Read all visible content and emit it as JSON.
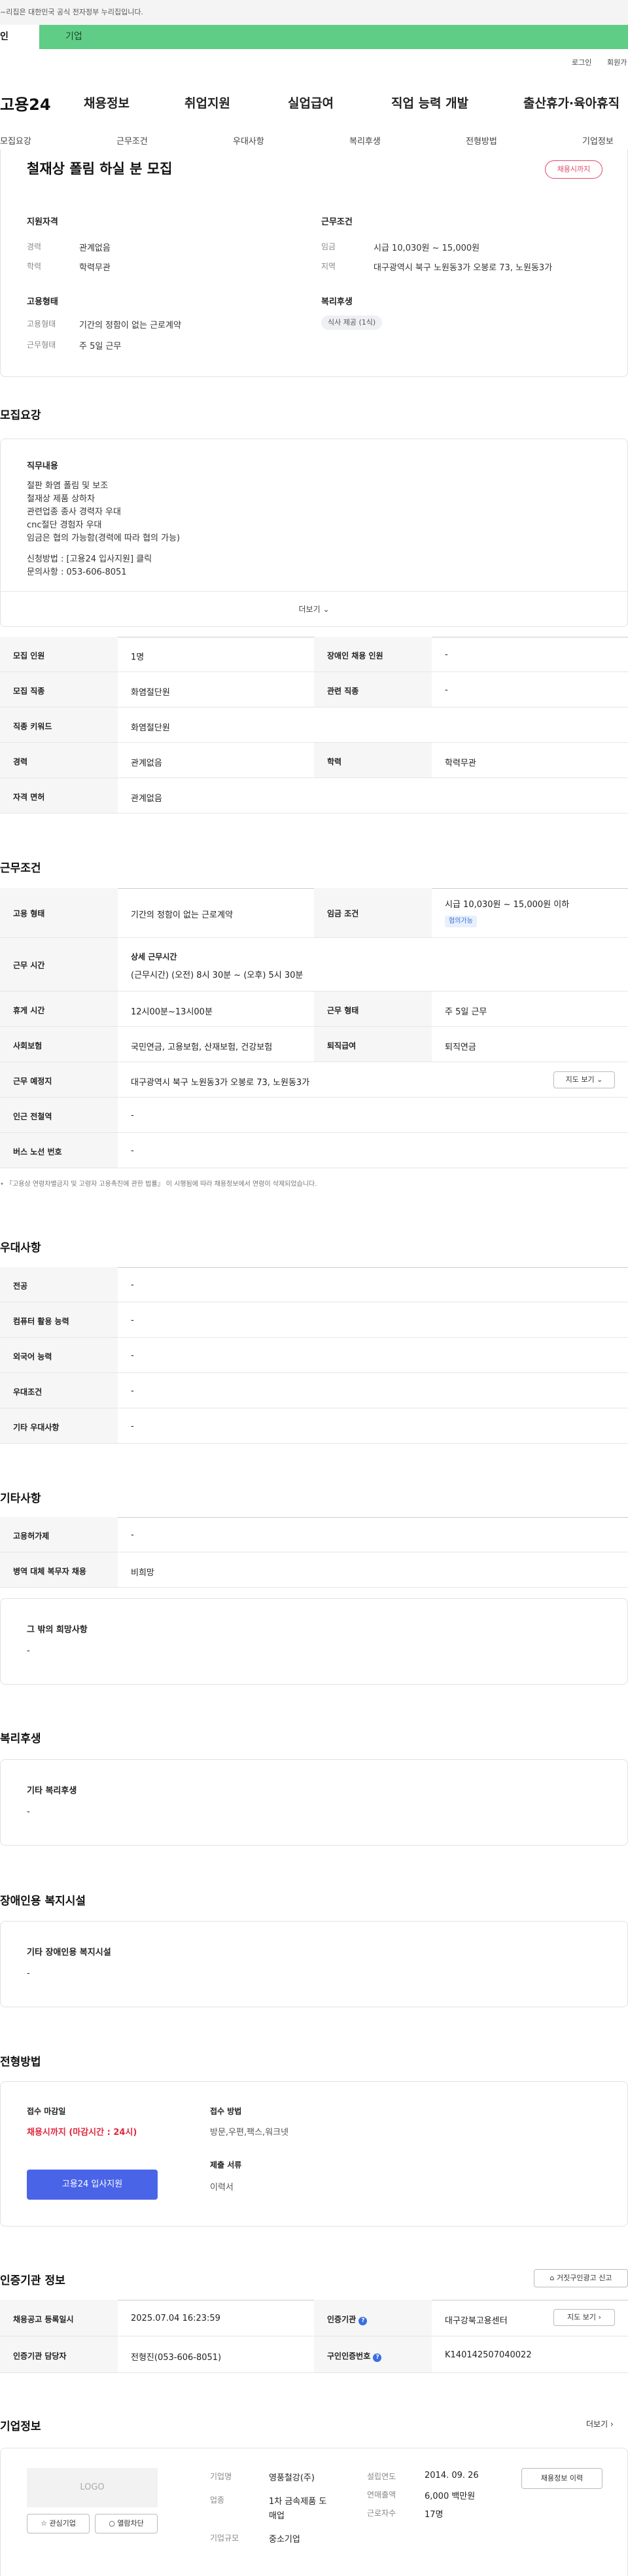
{
  "gov": {
    "notice": "~리집은 대한민국 공식 전자정부 누리집입니다."
  },
  "tabs": {
    "t1": "인",
    "t2": "기업"
  },
  "util": {
    "login": "로그인",
    "join": "회원가"
  },
  "logo": "고용24",
  "gnb": [
    "채용정보",
    "취업지원",
    "실업급여",
    "직업 능력 개발",
    "출산휴가·육아휴직"
  ],
  "lnb": [
    "모집요강",
    "근무조건",
    "우대사항",
    "복리후생",
    "전형방법",
    "기업정보"
  ],
  "summary": {
    "title": "철재상 폴림 하실 분 모집",
    "badge": "채용시까지",
    "qual_title": "지원자격",
    "qual_rows": [
      [
        "경력",
        "관계없음"
      ],
      [
        "학력",
        "학력무관"
      ]
    ],
    "emp_title": "고용형태",
    "emp_rows": [
      [
        "고용형태",
        "기간의 정함이 없는 근로계약"
      ],
      [
        "근무형태",
        "주 5일 근무"
      ]
    ],
    "cond_title": "근무조건",
    "cond_rows": [
      [
        "임금",
        "시급 10,030원 ~ 15,000원"
      ],
      [
        "지역",
        "대구광역시 북구 노원동3가 오봉로 73, 노원동3가"
      ]
    ],
    "welfare_title": "복리후생",
    "welfare_tag": "식사 제공 (1식)"
  },
  "recruit": {
    "title": "모집요강",
    "job_title": "직무내용",
    "lines": [
      "절판 화염 폴림 및 보조",
      "철재상 제품 상하차",
      "관련업종 종사 경력자 우대",
      "cnc절단 경험자 우대",
      "임금은 협의 가능함(경력에 따라 협의 가능)",
      "",
      "신청방법 : [고용24 입사지원] 클릭",
      "문의사항 : 053-606-8051"
    ],
    "more": "더보기",
    "rows": [
      {
        "k1": "모집 인원",
        "v1": "1명",
        "k2": "장애인 채용 인원",
        "v2": "-"
      },
      {
        "k1": "모집 직종",
        "v1": "화염절단원",
        "k2": "관련 직종",
        "v2": "-"
      },
      {
        "k1": "직종 키워드",
        "v1": "화염절단원"
      },
      {
        "k1": "경력",
        "v1": "관계없음",
        "k2": "학력",
        "v2": "학력무관"
      },
      {
        "k1": "자격 면허",
        "v1": "관계없음"
      }
    ]
  },
  "work": {
    "title": "근무조건",
    "type_k": "고용 형태",
    "type_v": "기간의 정함이 없는 근로계약",
    "wage_k": "임금 조건",
    "wage_v": "시급 10,030원 ~ 15,000원 이하",
    "wage_tag": "협의가능",
    "time_k": "근무 시간",
    "time_h": "상세 근무시간",
    "time_v": "(근무시간) (오전) 8시 30분 ~ (오후) 5시 30분",
    "rest_k": "휴게 시간",
    "rest_v": "12시00분~13시00분",
    "form_k": "근무 형태",
    "form_v": "주 5일 근무",
    "ins_k": "사회보험",
    "ins_v": "국민연금, 고용보험, 산재보험, 건강보험",
    "ret_k": "퇴직급여",
    "ret_v": "퇴직연금",
    "place_k": "근무 예정지",
    "place_v": "대구광역시 북구 노원동3가 오봉로 73, 노원동3가",
    "map_btn": "지도 보기",
    "sub_k": "인근 전철역",
    "sub_v": "-",
    "bus_k": "버스 노선 번호",
    "bus_v": "-",
    "note": "『고용상 연령차별금지 및 고령자 고용촉진에 관한 법률』 이 시행됨에 따라 채용정보에서 연령이 삭제되었습니다."
  },
  "pref": {
    "title": "우대사항",
    "rows": [
      [
        "전공",
        "-"
      ],
      [
        "컴퓨터 활용 능력",
        "-"
      ],
      [
        "외국어 능력",
        "-"
      ],
      [
        "우대조건",
        "-"
      ],
      [
        "기타 우대사항",
        "-"
      ]
    ]
  },
  "etc": {
    "title": "기타사항",
    "rows": [
      [
        "고용허가제",
        "-"
      ],
      [
        "병역 대체 복무자 채용",
        "비희망"
      ]
    ],
    "box_title": "그 밖의 희망사항",
    "box_val": "-"
  },
  "welfare": {
    "title": "복리후생",
    "box_title": "기타 복리후생",
    "box_val": "-"
  },
  "disabled": {
    "title": "장애인용 복지시설",
    "box_title": "기타 장애인용 복지시설",
    "box_val": "-"
  },
  "selection": {
    "title": "전형방법",
    "deadline_k": "접수 마감일",
    "deadline_v": "채용시까지 (마감시간 : 24시)",
    "apply_btn": "고용24 입사지원",
    "method_k": "접수 방법",
    "method_v": "방문,우편,팩스,워크넷",
    "doc_k": "제출 서류",
    "doc_v": "이력서"
  },
  "agency": {
    "title": "인증기관 정보",
    "report_btn": "거짓구인광고 신고",
    "reg_k": "채용공고 등록일시",
    "reg_v": "2025.07.04 16:23:59",
    "org_k": "인증기관",
    "org_v": "대구강북고용센터",
    "map_btn": "지도 보기",
    "mgr_k": "인증기관 담당자",
    "mgr_v": "전형진(053-606-8051)",
    "no_k": "구인인증번호",
    "no_v": "K140142507040022"
  },
  "company": {
    "title": "기업정보",
    "more": "더보기",
    "logo": "LOGO",
    "fav_btn": "관심기업",
    "block_btn": "열람차단",
    "name_k": "기업명",
    "name_v": "영풍철강(주)",
    "ind_k": "업종",
    "ind_v1": "1차 금속제품 도",
    "ind_v2": "매업",
    "size_k": "기업규모",
    "size_v": "중소기업",
    "est_k": "설립연도",
    "est_v": "2014. 09. 26",
    "sales_k": "연매출액",
    "sales_v": "6,000 백만원",
    "emp_k": "근로자수",
    "emp_v": "17명",
    "hist_btn": "채용정보 이력"
  }
}
